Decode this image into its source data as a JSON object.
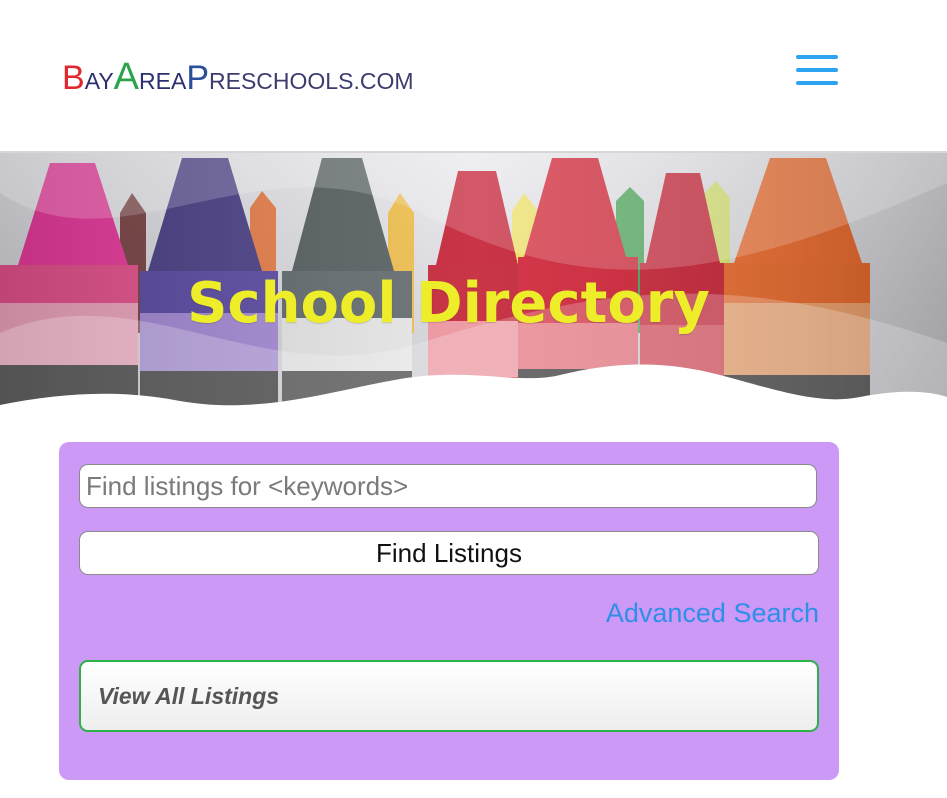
{
  "header": {
    "logo": {
      "b": "B",
      "ay": "AY",
      "a": "A",
      "rea": "REA",
      "p": "P",
      "rest": "RESCHOOLS.COM"
    },
    "menu_icon": "hamburger-menu-icon"
  },
  "hero": {
    "title": "School Directory"
  },
  "search": {
    "placeholder": "Find listings for <keywords>",
    "value": "",
    "find_button_label": "Find Listings",
    "advanced_link_label": "Advanced Search",
    "view_all_label": "View All Listings"
  },
  "colors": {
    "accent": "#2ea3f2",
    "panel_bg": "#cc99f7",
    "title_yellow": "#eded2a",
    "view_all_border": "#2bb34a",
    "link_blue": "#2e8fe8"
  }
}
